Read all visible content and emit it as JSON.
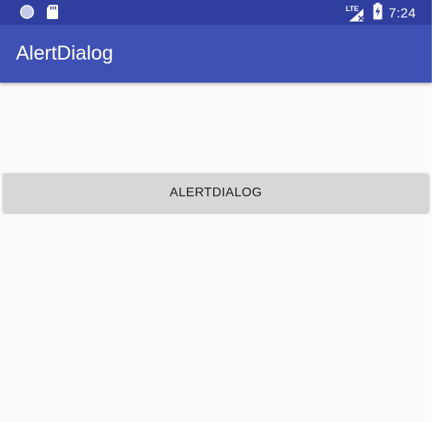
{
  "status_bar": {
    "time": "7:24",
    "network_label": "LTE",
    "icons": [
      "circle-icon",
      "sd-card-icon",
      "signal-icon",
      "battery-charging-icon"
    ],
    "background": "#303f9f"
  },
  "app_bar": {
    "title": "AlertDialog",
    "background": "#3f51b5"
  },
  "main": {
    "button_label": "ALERTDIALOG",
    "button_background": "#d6d7d7",
    "background": "#fafafa"
  }
}
